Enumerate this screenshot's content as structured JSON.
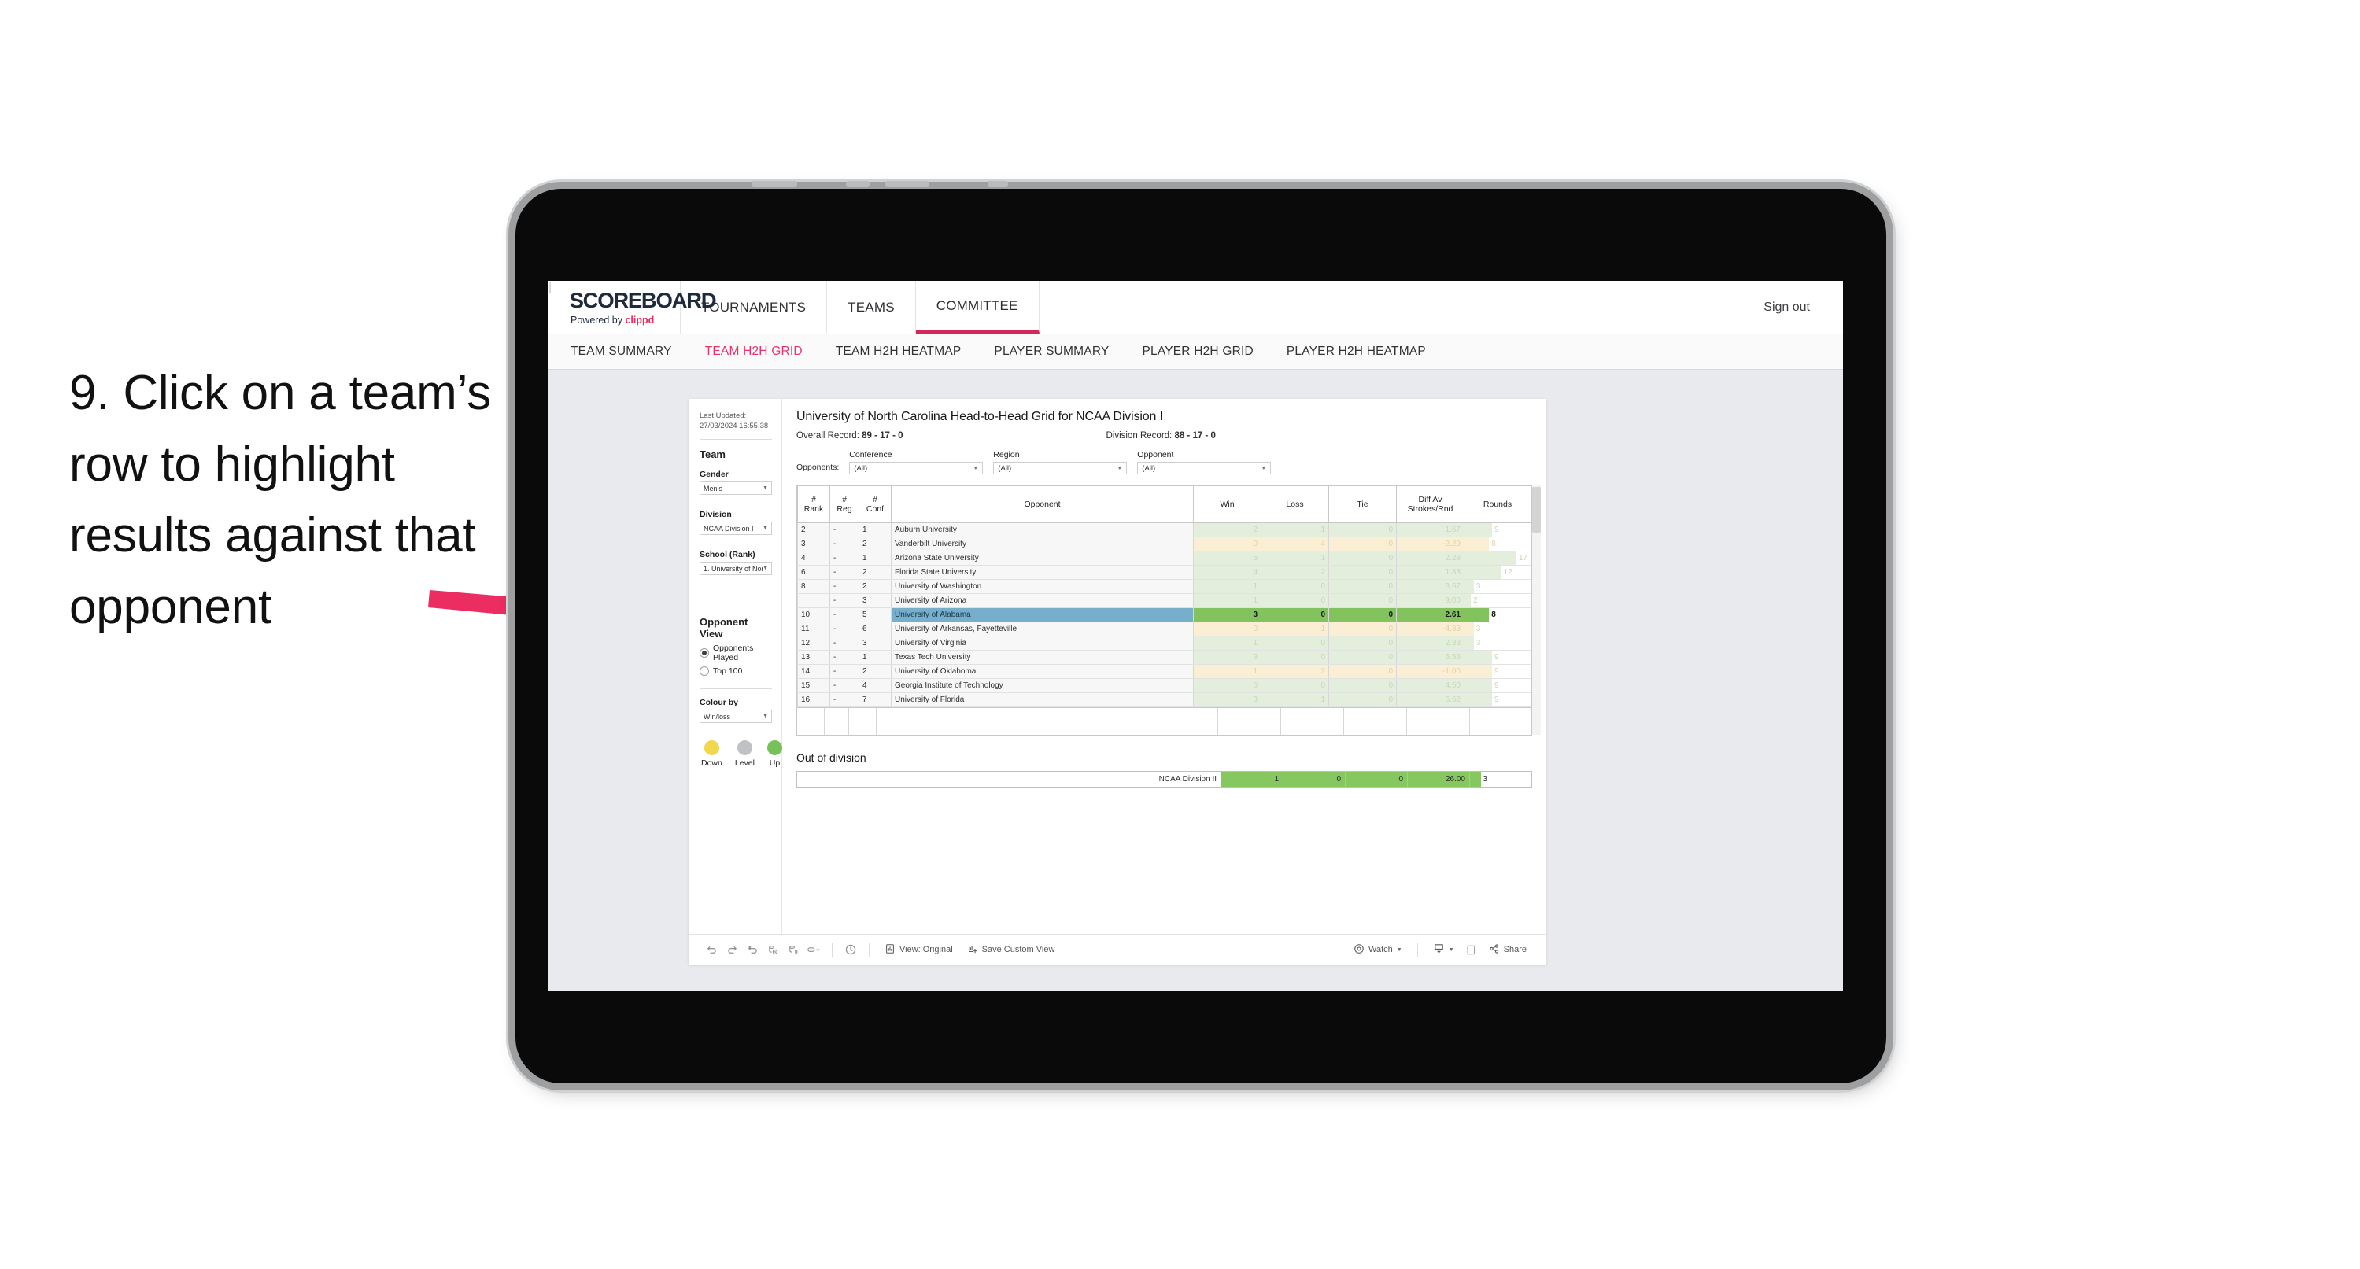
{
  "instruction": "9. Click on a team’s row to highlight results against that opponent",
  "app": {
    "brand": {
      "title": "SCOREBOARD",
      "powered_prefix": "Powered by ",
      "powered_brand": "clippd"
    },
    "topnav": [
      {
        "label": "TOURNAMENTS",
        "active": false
      },
      {
        "label": "TEAMS",
        "active": false
      },
      {
        "label": "COMMITTEE",
        "active": true
      }
    ],
    "signout": {
      "divider": "|",
      "label": "Sign out"
    },
    "subnav": [
      {
        "label": "TEAM SUMMARY",
        "active": false
      },
      {
        "label": "TEAM H2H GRID",
        "active": true
      },
      {
        "label": "TEAM H2H HEATMAP",
        "active": false
      },
      {
        "label": "PLAYER SUMMARY",
        "active": false
      },
      {
        "label": "PLAYER H2H GRID",
        "active": false
      },
      {
        "label": "PLAYER H2H HEATMAP",
        "active": false
      }
    ]
  },
  "sidebar": {
    "last_updated": "Last Updated: 27/03/2024 16:55:38",
    "team_heading": "Team",
    "gender": {
      "label": "Gender",
      "value": "Men’s"
    },
    "division": {
      "label": "Division",
      "value": "NCAA Division I"
    },
    "school": {
      "label": "School (Rank)",
      "value": "1. University of Nort..."
    },
    "opponent_view": {
      "heading": "Opponent View",
      "options": [
        {
          "label": "Opponents Played",
          "selected": true
        },
        {
          "label": "Top 100",
          "selected": false
        }
      ]
    },
    "colour_by": {
      "label": "Colour by",
      "value": "Win/loss"
    },
    "legend": [
      {
        "label": "Down",
        "color": "#f2d64b"
      },
      {
        "label": "Level",
        "color": "#bfc2c4"
      },
      {
        "label": "Up",
        "color": "#77c15b"
      }
    ]
  },
  "main": {
    "title": "University of North Carolina Head-to-Head Grid for NCAA Division I",
    "overall_record": {
      "label": "Overall Record: ",
      "value": "89 - 17 - 0"
    },
    "division_record": {
      "label": "Division Record: ",
      "value": "88 - 17 - 0"
    },
    "opponents_label": "Opponents:",
    "filters": [
      {
        "label": "Conference",
        "value": "(All)"
      },
      {
        "label": "Region",
        "value": "(All)"
      },
      {
        "label": "Opponent",
        "value": "(All)"
      }
    ],
    "columns": [
      "# Rank",
      "# Reg",
      "# Conf",
      "Opponent",
      "Win",
      "Loss",
      "Tie",
      "Diff Av Strokes/Rnd",
      "Rounds"
    ],
    "rows": [
      {
        "rank": "2",
        "reg": "-",
        "conf": "1",
        "opponent": "Auburn University",
        "win": "2",
        "loss": "1",
        "tie": "0",
        "diff": "1.67",
        "rounds": "9",
        "tone": "up",
        "highlight": false
      },
      {
        "rank": "3",
        "reg": "-",
        "conf": "2",
        "opponent": "Vanderbilt University",
        "win": "0",
        "loss": "4",
        "tie": "0",
        "diff": "-2.29",
        "rounds": "8",
        "tone": "down",
        "highlight": false
      },
      {
        "rank": "4",
        "reg": "-",
        "conf": "1",
        "opponent": "Arizona State University",
        "win": "5",
        "loss": "1",
        "tie": "0",
        "diff": "2.28",
        "rounds": "17",
        "tone": "up",
        "highlight": false
      },
      {
        "rank": "6",
        "reg": "-",
        "conf": "2",
        "opponent": "Florida State University",
        "win": "4",
        "loss": "2",
        "tie": "0",
        "diff": "1.83",
        "rounds": "12",
        "tone": "up",
        "highlight": false
      },
      {
        "rank": "8",
        "reg": "-",
        "conf": "2",
        "opponent": "University of Washington",
        "win": "1",
        "loss": "0",
        "tie": "0",
        "diff": "3.67",
        "rounds": "3",
        "tone": "up",
        "highlight": false
      },
      {
        "rank": "",
        "reg": "-",
        "conf": "3",
        "opponent": "University of Arizona",
        "win": "1",
        "loss": "0",
        "tie": "0",
        "diff": "9.00",
        "rounds": "2",
        "tone": "up",
        "highlight": false
      },
      {
        "rank": "10",
        "reg": "-",
        "conf": "5",
        "opponent": "University of Alabama",
        "win": "3",
        "loss": "0",
        "tie": "0",
        "diff": "2.61",
        "rounds": "8",
        "tone": "up",
        "highlight": true
      },
      {
        "rank": "11",
        "reg": "-",
        "conf": "6",
        "opponent": "University of Arkansas, Fayetteville",
        "win": "0",
        "loss": "1",
        "tie": "0",
        "diff": "-4.33",
        "rounds": "3",
        "tone": "down",
        "highlight": false
      },
      {
        "rank": "12",
        "reg": "-",
        "conf": "3",
        "opponent": "University of Virginia",
        "win": "1",
        "loss": "0",
        "tie": "0",
        "diff": "2.33",
        "rounds": "3",
        "tone": "up",
        "highlight": false
      },
      {
        "rank": "13",
        "reg": "-",
        "conf": "1",
        "opponent": "Texas Tech University",
        "win": "3",
        "loss": "0",
        "tie": "0",
        "diff": "5.56",
        "rounds": "9",
        "tone": "up",
        "highlight": false
      },
      {
        "rank": "14",
        "reg": "-",
        "conf": "2",
        "opponent": "University of Oklahoma",
        "win": "1",
        "loss": "2",
        "tie": "0",
        "diff": "-1.00",
        "rounds": "9",
        "tone": "down",
        "highlight": false
      },
      {
        "rank": "15",
        "reg": "-",
        "conf": "4",
        "opponent": "Georgia Institute of Technology",
        "win": "5",
        "loss": "0",
        "tie": "0",
        "diff": "4.50",
        "rounds": "9",
        "tone": "up",
        "highlight": false
      },
      {
        "rank": "16",
        "reg": "-",
        "conf": "7",
        "opponent": "University of Florida",
        "win": "3",
        "loss": "1",
        "tie": "0",
        "diff": "6.62",
        "rounds": "9",
        "tone": "up",
        "highlight": false
      }
    ],
    "out_of_division": {
      "heading": "Out of division",
      "row": {
        "name": "NCAA Division II",
        "win": "1",
        "loss": "0",
        "tie": "0",
        "diff": "26.00",
        "rounds": "3"
      }
    }
  },
  "toolbar": {
    "view_label": "View: Original",
    "save_label": "Save Custom View",
    "watch_label": "Watch",
    "share_label": "Share"
  },
  "chart_data": {
    "type": "table",
    "title": "University of North Carolina Head-to-Head Grid for NCAA Division I",
    "columns": [
      "# Rank",
      "# Reg",
      "# Conf",
      "Opponent",
      "Win",
      "Loss",
      "Tie",
      "Diff Av Strokes/Rnd",
      "Rounds"
    ],
    "rows": [
      [
        "2",
        "-",
        "1",
        "Auburn University",
        2,
        1,
        0,
        1.67,
        9
      ],
      [
        "3",
        "-",
        "2",
        "Vanderbilt University",
        0,
        4,
        0,
        -2.29,
        8
      ],
      [
        "4",
        "-",
        "1",
        "Arizona State University",
        5,
        1,
        0,
        2.28,
        17
      ],
      [
        "6",
        "-",
        "2",
        "Florida State University",
        4,
        2,
        0,
        1.83,
        12
      ],
      [
        "8",
        "-",
        "2",
        "University of Washington",
        1,
        0,
        0,
        3.67,
        3
      ],
      [
        "",
        "-",
        "3",
        "University of Arizona",
        1,
        0,
        0,
        9.0,
        2
      ],
      [
        "10",
        "-",
        "5",
        "University of Alabama",
        3,
        0,
        0,
        2.61,
        8
      ],
      [
        "11",
        "-",
        "6",
        "University of Arkansas, Fayetteville",
        0,
        1,
        0,
        -4.33,
        3
      ],
      [
        "12",
        "-",
        "3",
        "University of Virginia",
        1,
        0,
        0,
        2.33,
        3
      ],
      [
        "13",
        "-",
        "1",
        "Texas Tech University",
        3,
        0,
        0,
        5.56,
        9
      ],
      [
        "14",
        "-",
        "2",
        "University of Oklahoma",
        1,
        2,
        0,
        -1.0,
        9
      ],
      [
        "15",
        "-",
        "4",
        "Georgia Institute of Technology",
        5,
        0,
        0,
        4.5,
        9
      ],
      [
        "16",
        "-",
        "7",
        "University of Florida",
        3,
        1,
        0,
        6.62,
        9
      ]
    ],
    "out_of_division": [
      "NCAA Division II",
      1,
      0,
      0,
      26.0,
      3
    ],
    "highlighted_row": "University of Alabama",
    "colour_encoding": {
      "up": "#77c15b",
      "level": "#bfc2c4",
      "down": "#f2d64b"
    },
    "rounds_max": 17
  }
}
